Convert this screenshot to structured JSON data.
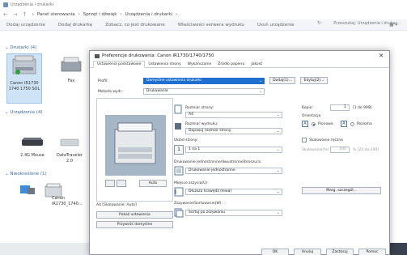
{
  "explorer": {
    "title": "Urządzenia i drukarki",
    "breadcrumb": [
      "Panel sterowania",
      "Sprzęt i dźwięk",
      "Urządzenia i drukarki"
    ],
    "search_placeholder": "Przeszukaj: Urządzenia i drukar...",
    "commands": [
      "Dodaj urządzenie",
      "Dodaj drukarkę",
      "Zobacz, co jest drukowane",
      "Właściwości serwera wydruku",
      "Usuń urządzenie"
    ],
    "sections": {
      "printers": "Drukarki (4)",
      "devices": "Urządzenia (4)",
      "unspecified": "Nieokreślone (1)"
    },
    "printers": [
      {
        "label": "Canon iR1730 1740 1750 SOL"
      },
      {
        "label": "Fax"
      }
    ],
    "devices": [
      {
        "label": "2.4G Mouse"
      },
      {
        "label": "DataTraveler 2.0"
      }
    ],
    "unspecified_device": "Canon iR1730_1740..."
  },
  "dialog": {
    "title": "Preferencje drukowania: Canon iR1730/1740/1750",
    "close": "✕",
    "tabs": [
      "Ustawienia podstawowe",
      "Ustawienia strony",
      "Wykańczanie",
      "Źródło papieru",
      "Jakość"
    ],
    "profile_label": "Profil:",
    "profile_value": "Domyślne ustawienia drukarki",
    "add_btn": "Dodaj(1)...",
    "edit_btn": "Edytuj(2)...",
    "output_label": "Metoda wydr.:",
    "output_value": "Drukowanie",
    "original_size_label": "Rozmiar strony:",
    "original_size_value": "A4",
    "output_size_label": "Rozmiar wydruku:",
    "output_size_value": "Dopasuj rozmiar strony",
    "copies_label": "Kopie:",
    "copies_value": "1",
    "copies_range": "[1 do 999]",
    "orientation_label": "Orientacja",
    "portrait": "Pionowa",
    "landscape": "Pozioma",
    "layout_label": "Układ strony:",
    "layout_value": "1 na 1",
    "manual_scaling": "Skalowanie ręczne",
    "scaling_label": "Skalowanie(%):",
    "scaling_value": "100",
    "scaling_range": "% [25 do 200]",
    "duplex_label": "Drukowanie jednostronne/dwustronne/broszura:",
    "duplex_value": "Drukowanie jednostronne",
    "finishing_label": "Miejsce zszycia(U):",
    "finishing_value": "Dłuższa krawędź (lewa)",
    "collate_label": "Zszywanie/Sortowanie(W):",
    "collate_value": "Sortuj po zszywaniu",
    "preview_label": "A4 [Skalowanie: Auto]",
    "preview_auto": "Auto",
    "view_settings_btn": "Pokaż ustawienia",
    "restore_btn": "Przywróć domyślne",
    "margin_btn": "Marg. szczegół...",
    "footer": {
      "ok": "OK",
      "cancel": "Anuluj",
      "apply": "Zastosuj",
      "help": "Pomoc"
    }
  }
}
